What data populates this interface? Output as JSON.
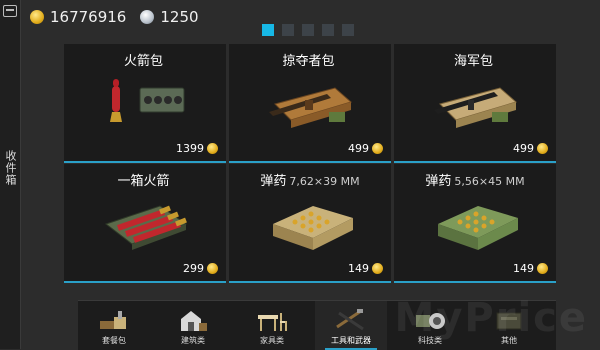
{
  "sidebar": {
    "label": "收件箱",
    "icon": "inbox-icon"
  },
  "currency": {
    "coins": "16776916",
    "gems": "1250"
  },
  "pagination": {
    "pages": 5,
    "active_index": 0
  },
  "cards": [
    {
      "title": "火箭包",
      "spec": "",
      "price": "1399",
      "art": "rocket-pack-icon"
    },
    {
      "title": "掠夺者包",
      "spec": "",
      "price": "499",
      "art": "raider-pack-icon"
    },
    {
      "title": "海军包",
      "spec": "",
      "price": "499",
      "art": "navy-pack-icon"
    },
    {
      "title": "一箱火箭",
      "spec": "",
      "price": "299",
      "art": "rocket-crate-icon"
    },
    {
      "title": "弹药",
      "spec": "7,62×39 MM",
      "price": "149",
      "art": "ammo-box-762-icon"
    },
    {
      "title": "弹药",
      "spec": "5,56×45 MM",
      "price": "149",
      "art": "ammo-box-556-icon"
    }
  ],
  "categories": [
    {
      "label": "套餐包",
      "icon": "bundle-icon",
      "active": false
    },
    {
      "label": "建筑类",
      "icon": "building-icon",
      "active": false
    },
    {
      "label": "家具类",
      "icon": "furniture-icon",
      "active": false
    },
    {
      "label": "工具和武器",
      "icon": "tools-weapons-icon",
      "active": true
    },
    {
      "label": "科技类",
      "icon": "tech-icon",
      "active": false
    },
    {
      "label": "其他",
      "icon": "other-icon",
      "active": false
    }
  ],
  "watermark": "MyPrice",
  "colors": {
    "accent": "#17b8e6",
    "card_bg": "#1b1b1b",
    "page_bg": "#2c2c2c",
    "coin": "#e2ad1c"
  }
}
